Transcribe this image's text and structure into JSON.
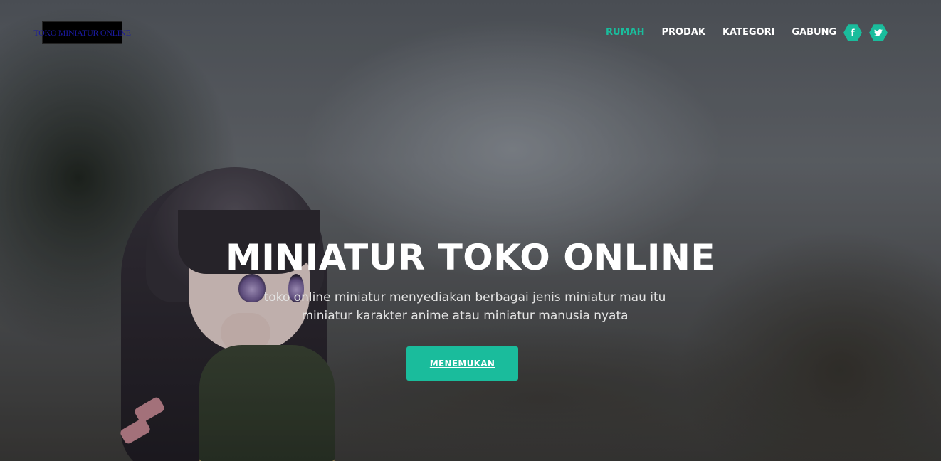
{
  "header": {
    "logo_text": "TOKO MINIATUR ONLINE",
    "nav": [
      {
        "label": "RUMAH",
        "active": true
      },
      {
        "label": "PRODAK",
        "active": false
      },
      {
        "label": "KATEGORI",
        "active": false
      },
      {
        "label": "GABUNG",
        "active": false
      }
    ],
    "social": [
      {
        "icon": "facebook-icon",
        "glyph": "f"
      },
      {
        "icon": "twitter-icon",
        "glyph": "t"
      }
    ]
  },
  "hero": {
    "title": "MINIATUR TOKO ONLINE",
    "subtitle_line1": "toko online miniatur menyediakan berbagai jenis miniatur mau itu",
    "subtitle_line2": "miniatur karakter anime atau miniatur manusia nyata",
    "cta_label": "MENEMUKAN"
  },
  "colors": {
    "accent": "#1abc9c",
    "nav_text": "#ffffff",
    "title_text": "#ffffff"
  }
}
